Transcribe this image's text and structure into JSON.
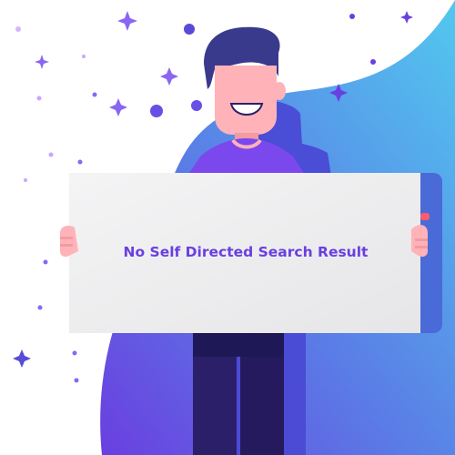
{
  "sign": {
    "message": "No Self Directed Search Result"
  },
  "palette": {
    "blob_light": "#4fc3ee",
    "blob_dark": "#6a3fe0",
    "shadow_figure": "#4a4ad6",
    "shirt": "#7b48ee",
    "hair": "#3a3a8c",
    "skin": "#ffb3b8",
    "pants": "#2b1f6a",
    "board": "#eeeeef",
    "board_edge": "#4a6ad8",
    "text": "#6a3fe0",
    "sparkle": "#7a5cf0"
  },
  "icons": [
    "sparkle-icon",
    "dot-icon"
  ]
}
